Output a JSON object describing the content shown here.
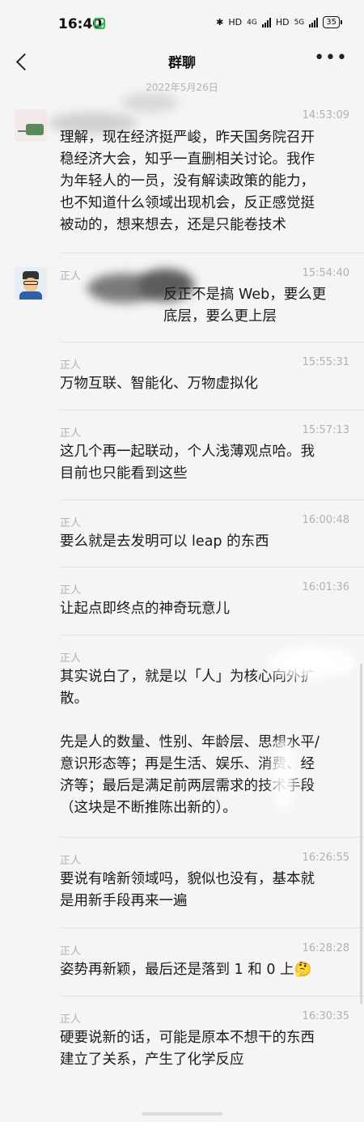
{
  "status": {
    "time": "16:40",
    "net1": "HD",
    "gen1": "4G",
    "net2": "HD",
    "gen2": "5G",
    "battery": "35"
  },
  "nav": {
    "title": "群聊"
  },
  "date_divider": "2022年5月26日",
  "messages": [
    {
      "sender": "",
      "time": "14:53:09",
      "text": "理解，现在经济挺严峻，昨天国务院召开\n稳经济大会，知乎一直删相关讨论。我作\n为年轻人的一员，没有解读政策的能力，\n也不知道什么领域出现机会，反正感觉挺\n被动的，想来想去，还是只能卷技术"
    },
    {
      "sender": "正人",
      "time": "15:54:40",
      "text": "反正不是搞 Web，要么更\n底层，要么更上层"
    },
    {
      "sender": "正人",
      "time": "15:55:31",
      "text": "万物互联、智能化、万物虚拟化"
    },
    {
      "sender": "正人",
      "time": "15:57:13",
      "text": "这几个再一起联动，个人浅薄观点哈。我\n目前也只能看到这些"
    },
    {
      "sender": "正人",
      "time": "16:00:48",
      "text": "要么就是去发明可以 leap 的东西"
    },
    {
      "sender": "正人",
      "time": "16:01:36",
      "text": "让起点即终点的神奇玩意儿"
    },
    {
      "sender": "正人",
      "time": "",
      "text": "其实说白了，就是以「人」为核心向外扩\n散。\n\n先是人的数量、性别、年龄层、思想水平/\n意识形态等；再是生活、娱乐、消费、经\n济等；最后是满足前两层需求的技术手段\n（这块是不断推陈出新的）。"
    },
    {
      "sender": "正人",
      "time": "16:26:55",
      "text": "要说有啥新领域吗，貌似也没有，基本就\n是用新手段再来一遍"
    },
    {
      "sender": "正人",
      "time": "16:28:28",
      "text": "姿势再新颖，最后还是落到 1 和 0 上🤔"
    },
    {
      "sender": "正人",
      "time": "16:30:35",
      "text": "硬要说新的话，可能是原本不想干的东西\n建立了关系，产生了化学反应"
    }
  ]
}
